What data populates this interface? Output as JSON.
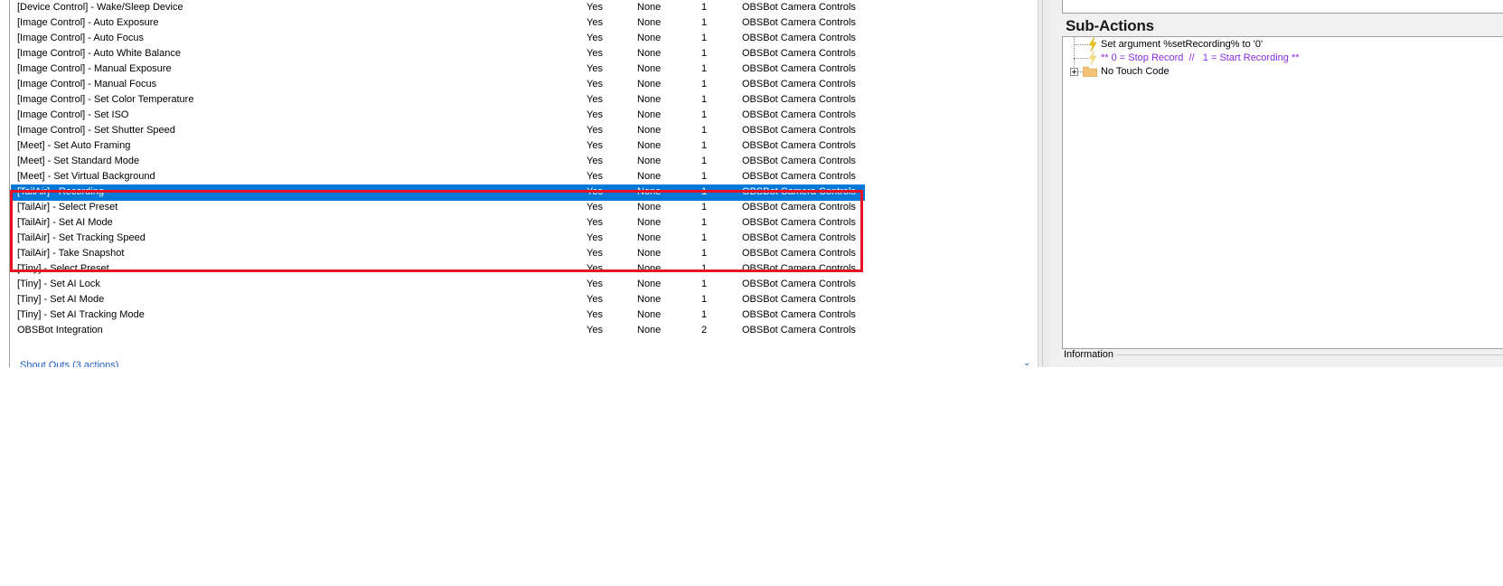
{
  "actions_list": {
    "rows": [
      {
        "name": "[Device Control] - Wake/Sleep Device",
        "enabled": "Yes",
        "trigger": "None",
        "count": "1",
        "group": "OBSBot Camera Controls"
      },
      {
        "name": "[Image Control] - Auto Exposure",
        "enabled": "Yes",
        "trigger": "None",
        "count": "1",
        "group": "OBSBot Camera Controls"
      },
      {
        "name": "[Image Control] - Auto Focus",
        "enabled": "Yes",
        "trigger": "None",
        "count": "1",
        "group": "OBSBot Camera Controls"
      },
      {
        "name": "[Image Control] - Auto White Balance",
        "enabled": "Yes",
        "trigger": "None",
        "count": "1",
        "group": "OBSBot Camera Controls"
      },
      {
        "name": "[Image Control] - Manual Exposure",
        "enabled": "Yes",
        "trigger": "None",
        "count": "1",
        "group": "OBSBot Camera Controls"
      },
      {
        "name": "[Image Control] - Manual Focus",
        "enabled": "Yes",
        "trigger": "None",
        "count": "1",
        "group": "OBSBot Camera Controls"
      },
      {
        "name": "[Image Control] - Set Color Temperature",
        "enabled": "Yes",
        "trigger": "None",
        "count": "1",
        "group": "OBSBot Camera Controls"
      },
      {
        "name": "[Image Control] - Set ISO",
        "enabled": "Yes",
        "trigger": "None",
        "count": "1",
        "group": "OBSBot Camera Controls"
      },
      {
        "name": "[Image Control] - Set Shutter Speed",
        "enabled": "Yes",
        "trigger": "None",
        "count": "1",
        "group": "OBSBot Camera Controls"
      },
      {
        "name": "[Meet] - Set Auto Framing",
        "enabled": "Yes",
        "trigger": "None",
        "count": "1",
        "group": "OBSBot Camera Controls"
      },
      {
        "name": "[Meet] - Set Standard Mode",
        "enabled": "Yes",
        "trigger": "None",
        "count": "1",
        "group": "OBSBot Camera Controls"
      },
      {
        "name": "[Meet] - Set Virtual Background",
        "enabled": "Yes",
        "trigger": "None",
        "count": "1",
        "group": "OBSBot Camera Controls"
      },
      {
        "name": "[TailAir] - Recording",
        "enabled": "Yes",
        "trigger": "None",
        "count": "1",
        "group": "OBSBot Camera Controls",
        "selected": true
      },
      {
        "name": "[TailAir] - Select Preset",
        "enabled": "Yes",
        "trigger": "None",
        "count": "1",
        "group": "OBSBot Camera Controls"
      },
      {
        "name": "[TailAir] - Set AI Mode",
        "enabled": "Yes",
        "trigger": "None",
        "count": "1",
        "group": "OBSBot Camera Controls"
      },
      {
        "name": "[TailAir] - Set Tracking Speed",
        "enabled": "Yes",
        "trigger": "None",
        "count": "1",
        "group": "OBSBot Camera Controls"
      },
      {
        "name": "[TailAir] - Take Snapshot",
        "enabled": "Yes",
        "trigger": "None",
        "count": "1",
        "group": "OBSBot Camera Controls"
      },
      {
        "name": "[Tiny] - Select Preset",
        "enabled": "Yes",
        "trigger": "None",
        "count": "1",
        "group": "OBSBot Camera Controls"
      },
      {
        "name": "[Tiny] - Set AI Lock",
        "enabled": "Yes",
        "trigger": "None",
        "count": "1",
        "group": "OBSBot Camera Controls"
      },
      {
        "name": "[Tiny] - Set AI Mode",
        "enabled": "Yes",
        "trigger": "None",
        "count": "1",
        "group": "OBSBot Camera Controls"
      },
      {
        "name": "[Tiny] - Set AI Tracking Mode",
        "enabled": "Yes",
        "trigger": "None",
        "count": "1",
        "group": "OBSBot Camera Controls"
      },
      {
        "name": "OBSBot Integration",
        "enabled": "Yes",
        "trigger": "None",
        "count": "2",
        "group": "OBSBot Camera Controls"
      }
    ],
    "group_footer": "Shout Outs (3 actions)",
    "collapse_icon": "chevron-down-icon"
  },
  "colors": {
    "selection": "#0078d7",
    "highlight_box": "#e81123",
    "comment_text": "#8a2be2",
    "bolt": "#f0c419",
    "folder": "#f5c27a"
  },
  "subactions": {
    "title": "Sub-Actions",
    "items": [
      {
        "text": "Set argument %setRecording% to '0'",
        "icon": "lightning-bolt-icon",
        "kind": "action"
      },
      {
        "text": "** 0 = Stop Record  //   1 = Start Recording **",
        "icon": "lightning-bolt-icon",
        "kind": "comment"
      },
      {
        "text": "No Touch Code",
        "icon": "folder-icon",
        "kind": "group"
      }
    ]
  },
  "information": {
    "label": "Information"
  }
}
